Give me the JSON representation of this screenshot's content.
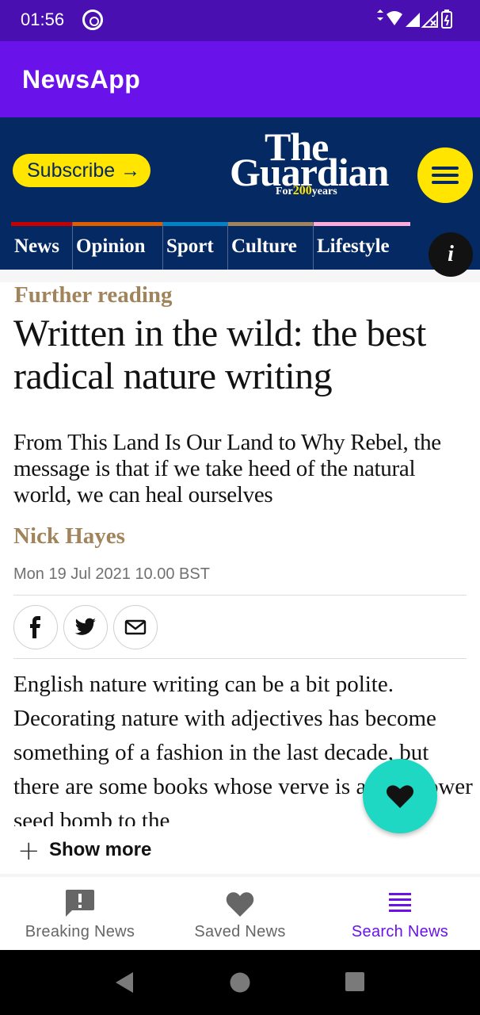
{
  "status_bar": {
    "time": "01:56",
    "network_label": "4"
  },
  "app_bar": {
    "title": "NewsApp"
  },
  "guardian": {
    "subscribe_label": "Subscribe →",
    "logo_line1": "The",
    "logo_line2": "Guardian",
    "logo_tag_prefix": "For",
    "logo_tag_number": "200",
    "logo_tag_suffix": "years",
    "brand_navy": "#052962",
    "brand_yellow": "#ffe500"
  },
  "nav": {
    "items": [
      {
        "label": "News",
        "stripe": "#c70000"
      },
      {
        "label": "Opinion",
        "stripe": "#e05e00"
      },
      {
        "label": "Sport",
        "stripe": "#0084c6"
      },
      {
        "label": "Culture",
        "stripe": "#a1845c"
      },
      {
        "label": "Lifestyle",
        "stripe": "#ffabdb"
      }
    ],
    "info_label": "i"
  },
  "article": {
    "kicker": "Further reading",
    "headline": "Written in the wild: the best radical nature writing",
    "standfirst": "From This Land Is Our Land to Why Rebel, the message is that if we take heed of the natural world, we can heal ourselves",
    "byline": "Nick Hayes",
    "date": "Mon 19 Jul 2021 10.00 BST",
    "body": "English nature writing can be a bit polite. Decorating nature with adjectives has become something of a fashion in the last decade, but there are some books whose verve is a wildflower seed bomb to the",
    "show_more_label": "Show more",
    "share": [
      "facebook-icon",
      "twitter-icon",
      "email-icon"
    ]
  },
  "bottom_nav": {
    "items": [
      {
        "label": "Breaking News",
        "icon": "alert-message-icon",
        "active": false
      },
      {
        "label": "Saved News",
        "icon": "heart-icon",
        "active": false
      },
      {
        "label": "Search News",
        "icon": "list-icon",
        "active": true
      }
    ],
    "active_color": "#6a12ea",
    "inactive_color": "#666666"
  },
  "fab": {
    "icon": "heart-icon",
    "color": "#1fd8c4"
  }
}
